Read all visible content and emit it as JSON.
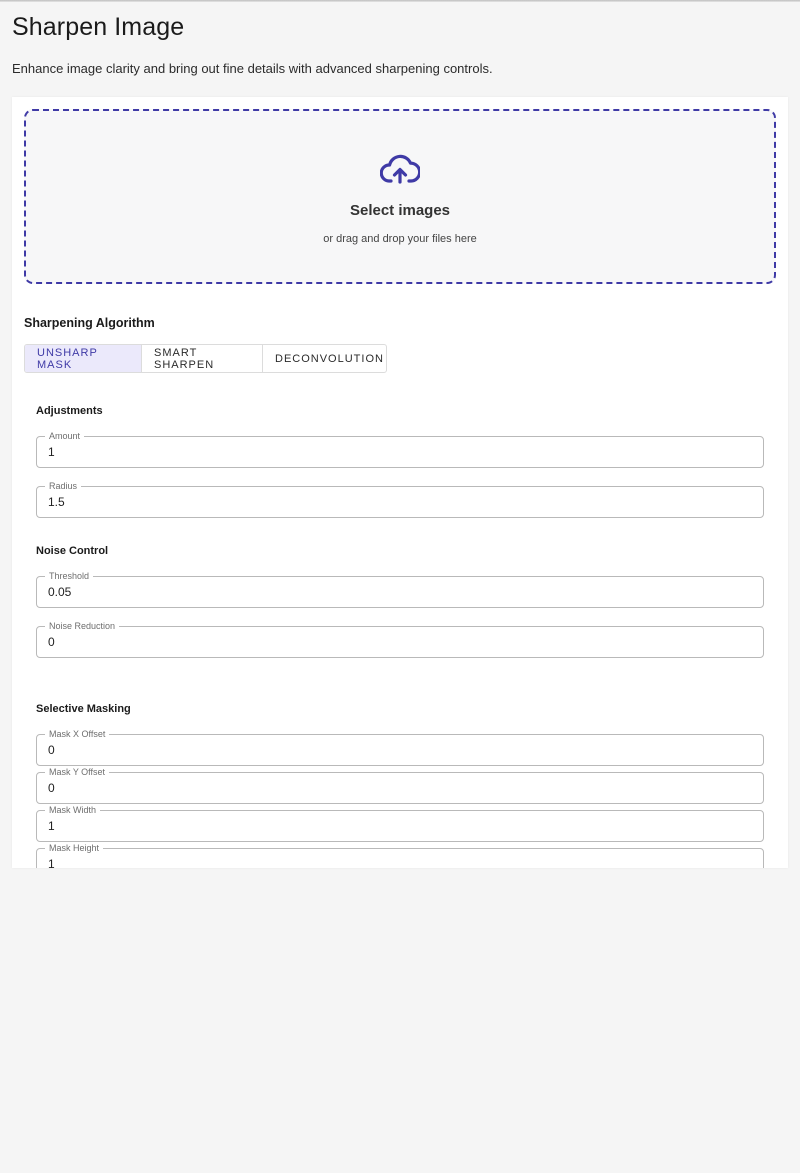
{
  "page": {
    "title": "Sharpen Image",
    "subtitle": "Enhance image clarity and bring out fine details with advanced sharpening controls."
  },
  "dropzone": {
    "icon": "cloud-upload-icon",
    "title": "Select images",
    "hint": "or drag and drop your files here"
  },
  "algorithm": {
    "label": "Sharpening Algorithm",
    "tabs": [
      "UNSHARP MASK",
      "SMART SHARPEN",
      "DECONVOLUTION"
    ],
    "selected": "UNSHARP MASK"
  },
  "adjustments": {
    "label": "Adjustments",
    "amount": {
      "label": "Amount",
      "value": "1"
    },
    "radius": {
      "label": "Radius",
      "value": "1.5"
    }
  },
  "noise": {
    "label": "Noise Control",
    "threshold": {
      "label": "Threshold",
      "value": "0.05"
    },
    "reduction": {
      "label": "Noise Reduction",
      "value": "0"
    }
  },
  "masking": {
    "label": "Selective Masking",
    "x_offset": {
      "label": "Mask X Offset",
      "value": "0"
    },
    "y_offset": {
      "label": "Mask Y Offset",
      "value": "0"
    },
    "width": {
      "label": "Mask Width",
      "value": "1"
    },
    "height": {
      "label": "Mask Height",
      "value": "1"
    }
  },
  "colors": {
    "accent": "#3f3aa6",
    "tab_active_bg": "#ebe9fb",
    "page_bg": "#f5f5f5"
  }
}
